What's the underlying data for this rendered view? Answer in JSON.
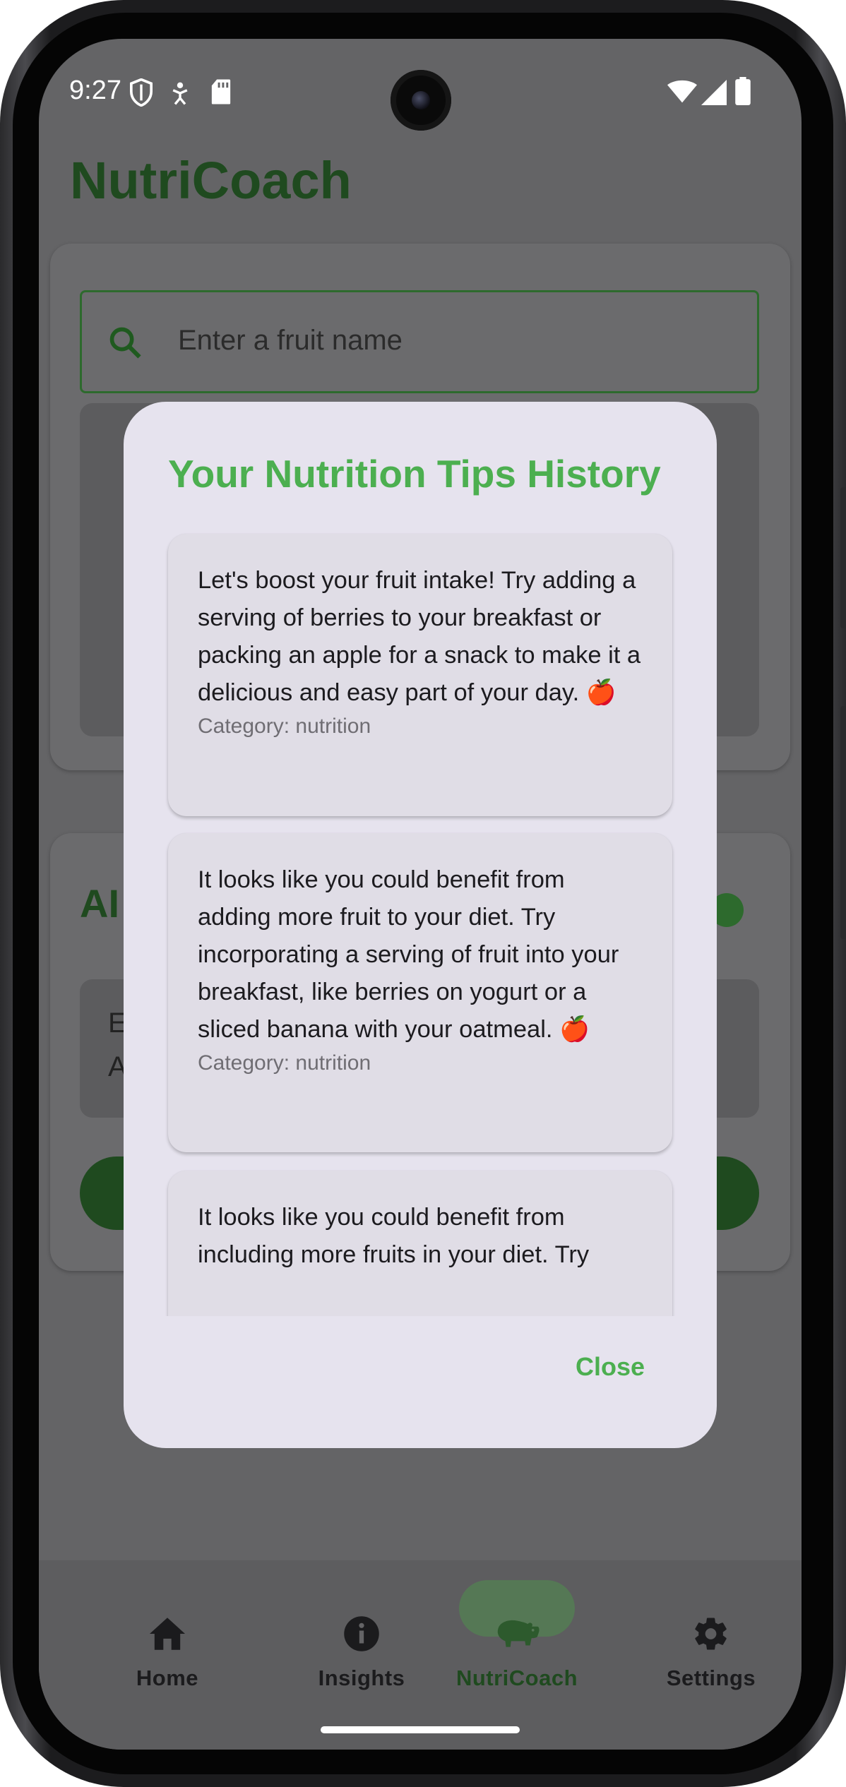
{
  "status_bar": {
    "time": "9:27",
    "left_icons": [
      "shield-icon",
      "accessibility-icon",
      "sd-card-icon"
    ],
    "right_icons": [
      "wifi-icon",
      "signal-icon",
      "battery-icon"
    ]
  },
  "app": {
    "title": "NutriCoach",
    "search_placeholder": "Enter a fruit name",
    "section_heading_partial": "AI",
    "section_text_partial_1": "E",
    "section_text_partial_2": "A"
  },
  "dialog": {
    "title": "Your Nutrition Tips History",
    "tips": [
      {
        "text": "Let's boost your fruit intake! Try adding a serving of berries to your breakfast or packing an apple for a snack to make it a delicious and easy part of your day. 🍎",
        "category": "Category: nutrition"
      },
      {
        "text": "It looks like you could benefit from adding more fruit to your diet. Try incorporating a serving of fruit into your breakfast, like berries on yogurt or a sliced banana with your oatmeal. 🍎",
        "category": "Category: nutrition"
      },
      {
        "text": "It looks like you could benefit from including more fruits in your diet. Try",
        "category": ""
      }
    ],
    "close_label": "Close"
  },
  "bottom_nav": {
    "items": [
      {
        "label": "Home",
        "icon": "home-icon"
      },
      {
        "label": "Insights",
        "icon": "info-icon"
      },
      {
        "label": "NutriCoach",
        "icon": "hippo-icon",
        "selected": true
      },
      {
        "label": "Settings",
        "icon": "gear-icon"
      }
    ]
  },
  "colors": {
    "accent_green": "#4caf50",
    "dark_green": "#1f4a1f",
    "dialog_bg": "#e6e3ee",
    "scrim_bg": "#646466"
  }
}
